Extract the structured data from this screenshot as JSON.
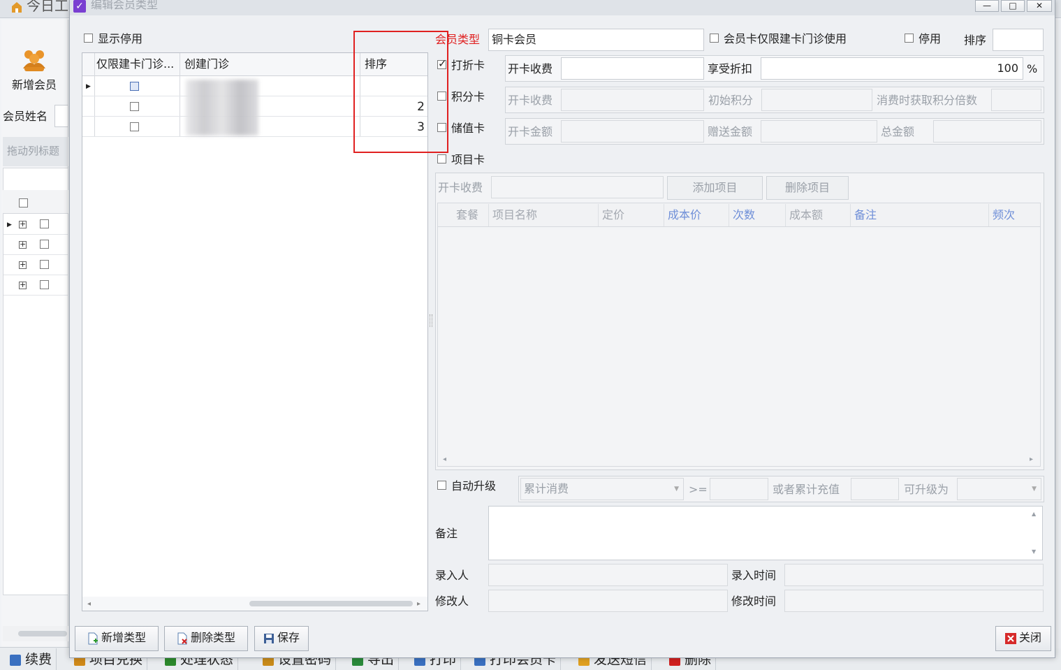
{
  "parent": {
    "title": "今日工",
    "new_member_label": "新增会员",
    "member_name_label": "会员姓名",
    "drag_hint": "拖动列标题",
    "tree_rows": [
      "+",
      "+",
      "+",
      "+"
    ],
    "bottom_toolbar": [
      {
        "label": "续费",
        "icon": "renew-icon"
      },
      {
        "label": "项目兑换",
        "icon": "exchange-icon"
      },
      {
        "label": "处理状态",
        "icon": "status-icon"
      },
      {
        "label": "设置密码",
        "icon": "password-icon"
      },
      {
        "label": "导出",
        "icon": "excel-icon"
      },
      {
        "label": "打印",
        "icon": "print-icon"
      },
      {
        "label": "打印会员卡",
        "icon": "print-card-icon"
      },
      {
        "label": "发送短信",
        "icon": "sms-icon"
      },
      {
        "label": "删除",
        "icon": "delete-icon"
      }
    ]
  },
  "dialog": {
    "title": "编辑会员类型",
    "window_controls": {
      "minimize": "—",
      "maximize": "□",
      "close": "✕"
    },
    "left": {
      "show_disabled_label": "显示停用",
      "grid_headers": {
        "restrict": "仅限建卡门诊...",
        "clinic": "创建门诊",
        "sort": "排序"
      },
      "rows": [
        {
          "restrict_checked": false,
          "clinic": "",
          "sort": "",
          "current": true
        },
        {
          "restrict_checked": false,
          "clinic": "",
          "sort": "2",
          "current": false
        },
        {
          "restrict_checked": false,
          "clinic": "",
          "sort": "3",
          "current": false
        }
      ]
    },
    "right": {
      "member_type_label": "会员类型",
      "member_type_value": "铜卡会员",
      "restrict_only_label": "会员卡仅限建卡门诊使用",
      "disabled_label": "停用",
      "sort_label": "排序",
      "sort_value": "",
      "discount_card": {
        "label": "打折卡",
        "checked": true,
        "fee_label": "开卡收费",
        "fee_value": "",
        "discount_label": "享受折扣",
        "discount_value": "100",
        "unit": "%"
      },
      "points_card": {
        "label": "积分卡",
        "checked": false,
        "fee_label": "开卡收费",
        "initial_label": "初始积分",
        "multiple_label": "消费时获取积分倍数"
      },
      "stored_card": {
        "label": "储值卡",
        "checked": false,
        "amount_label": "开卡金额",
        "gift_label": "赠送金额",
        "total_label": "总金额"
      },
      "item_card": {
        "label": "项目卡",
        "checked": false,
        "fee_label": "开卡收费",
        "add_button": "添加项目",
        "delete_button": "删除项目",
        "columns": [
          {
            "label": "套餐",
            "blue": false
          },
          {
            "label": "项目名称",
            "blue": false
          },
          {
            "label": "定价",
            "blue": false
          },
          {
            "label": "成本价",
            "blue": true
          },
          {
            "label": "次数",
            "blue": true
          },
          {
            "label": "成本额",
            "blue": false
          },
          {
            "label": "备注",
            "blue": true
          },
          {
            "label": "频次",
            "blue": true
          }
        ]
      },
      "auto_upgrade": {
        "label": "自动升级",
        "checked": false,
        "select_value": "累计消费",
        "op": ">=",
        "or_label": "或者累计充值",
        "upgrade_to_label": "可升级为"
      },
      "remark_label": "备注",
      "entered_by_label": "录入人",
      "entered_time_label": "录入时间",
      "modified_by_label": "修改人",
      "modified_time_label": "修改时间"
    },
    "buttons": {
      "add_type": "新增类型",
      "delete_type": "删除类型",
      "save": "保存",
      "close": "关闭"
    },
    "colors": {
      "accent_red": "#e02020",
      "blue_header": "#6f8fd8",
      "title_bar": "#dfe3e8"
    }
  }
}
